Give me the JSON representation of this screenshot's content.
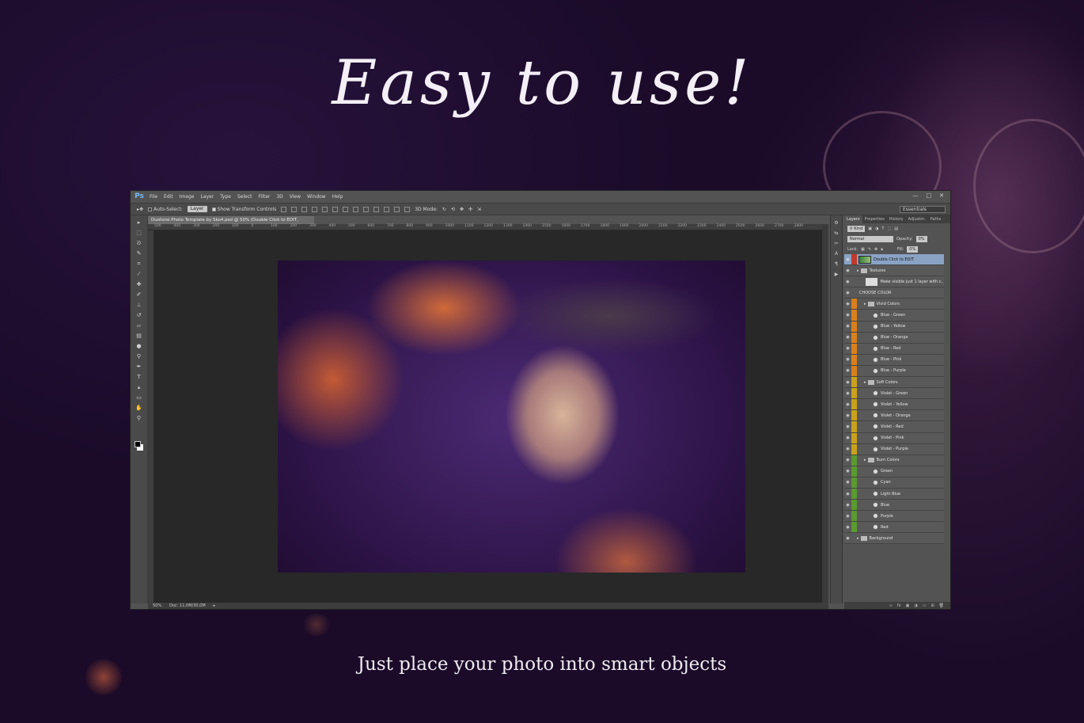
{
  "headline": "Easy to use!",
  "tagline": "Just place your photo into smart objects",
  "app": {
    "logo": "Ps",
    "menu": [
      "File",
      "Edit",
      "Image",
      "Layer",
      "Type",
      "Select",
      "Filter",
      "3D",
      "View",
      "Window",
      "Help"
    ],
    "window_buttons": [
      "—",
      "□",
      "✕"
    ]
  },
  "options": {
    "auto_select": "Auto-Select:",
    "auto_select_target": "Layer",
    "show_transform": "Show Transform Controls",
    "mode_3d": "3D Mode:",
    "workspace": "Essentials"
  },
  "document": {
    "tab_title": "Duotone Photo Template by Sko4.psd @ 50% (Double Click to EDIT, RGB/8)",
    "zoom": "50%",
    "doc_size": "Doc: 11,0M/30,0M",
    "ruler_ticks": [
      "500",
      "400",
      "300",
      "200",
      "100",
      "0",
      "100",
      "200",
      "300",
      "400",
      "500",
      "600",
      "700",
      "800",
      "900",
      "1000",
      "1100",
      "1200",
      "1300",
      "1400",
      "1500",
      "1600",
      "1700",
      "1800",
      "1900",
      "2000",
      "2100",
      "2200",
      "2300",
      "2400",
      "2500",
      "2600",
      "2700",
      "2800"
    ]
  },
  "layers_panel": {
    "tabs": [
      "Layers",
      "Properties",
      "History",
      "Adjustm.",
      "Paths"
    ],
    "kind_label": "Kind",
    "blend_mode": "Normal",
    "opacity_label": "Opacity:",
    "opacity_value": "0%",
    "lock_label": "Lock:",
    "fill_label": "Fill:",
    "fill_value": "0%",
    "colors": {
      "red": "#c0392b",
      "orange": "#d7801e",
      "yellow": "#c8a21e",
      "green": "#5a9a30",
      "selected": "#8aa3c4"
    },
    "layers": [
      {
        "name": "Double Click to EDIT",
        "indent": 0,
        "type": "photo",
        "tag": "red",
        "selected": true
      },
      {
        "name": "Textures",
        "indent": 0,
        "type": "folder",
        "tag": ""
      },
      {
        "name": "Make visible just 1 layer with c...",
        "indent": 1,
        "type": "thumb",
        "tag": ""
      },
      {
        "name": "CHOOSE COLOR",
        "indent": 0,
        "type": "text",
        "tag": ""
      },
      {
        "name": "Vivid Colors",
        "indent": 1,
        "type": "folder",
        "tag": "orange"
      },
      {
        "name": "Blue - Green",
        "indent": 2,
        "type": "adj",
        "tag": "orange"
      },
      {
        "name": "Blue - Yellow",
        "indent": 2,
        "type": "adj",
        "tag": "orange"
      },
      {
        "name": "Blue - Orange",
        "indent": 2,
        "type": "adj",
        "tag": "orange"
      },
      {
        "name": "Blue - Red",
        "indent": 2,
        "type": "adj",
        "tag": "orange"
      },
      {
        "name": "Blue - Pink",
        "indent": 2,
        "type": "adj",
        "tag": "orange"
      },
      {
        "name": "Blue - Purple",
        "indent": 2,
        "type": "adj",
        "tag": "orange"
      },
      {
        "name": "Soft Colors",
        "indent": 1,
        "type": "folder",
        "tag": "yellow"
      },
      {
        "name": "Violet - Green",
        "indent": 2,
        "type": "adj",
        "tag": "yellow"
      },
      {
        "name": "Violet - Yellow",
        "indent": 2,
        "type": "adj",
        "tag": "yellow"
      },
      {
        "name": "Violet - Orange",
        "indent": 2,
        "type": "adj",
        "tag": "yellow"
      },
      {
        "name": "Violet - Red",
        "indent": 2,
        "type": "adj",
        "tag": "yellow"
      },
      {
        "name": "Violet - Pink",
        "indent": 2,
        "type": "adj",
        "tag": "yellow"
      },
      {
        "name": "Violet - Purple",
        "indent": 2,
        "type": "adj",
        "tag": "yellow"
      },
      {
        "name": "Burn Colors",
        "indent": 1,
        "type": "folder",
        "tag": "green"
      },
      {
        "name": "Green",
        "indent": 2,
        "type": "adj",
        "tag": "green"
      },
      {
        "name": "Cyan",
        "indent": 2,
        "type": "adj",
        "tag": "green"
      },
      {
        "name": "Light Blue",
        "indent": 2,
        "type": "adj",
        "tag": "green"
      },
      {
        "name": "Blue",
        "indent": 2,
        "type": "adj",
        "tag": "green"
      },
      {
        "name": "Purple",
        "indent": 2,
        "type": "adj",
        "tag": "green"
      },
      {
        "name": "Red",
        "indent": 2,
        "type": "adj",
        "tag": "green"
      },
      {
        "name": "Background",
        "indent": 0,
        "type": "folder",
        "tag": ""
      }
    ],
    "bottom_icons": [
      "link-icon",
      "fx-icon",
      "mask-icon",
      "adjustment-icon",
      "folder-icon",
      "new-layer-icon",
      "trash-icon"
    ]
  }
}
